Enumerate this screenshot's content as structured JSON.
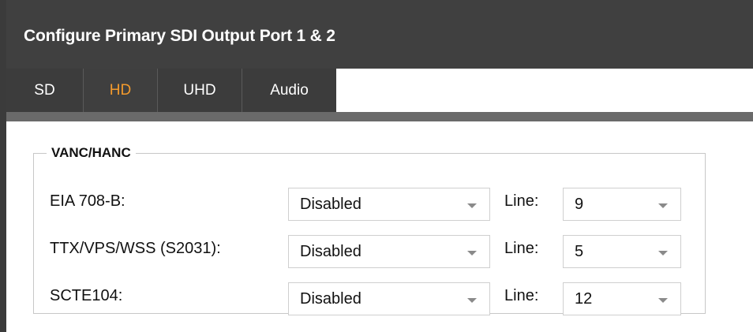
{
  "title": "Configure Primary SDI Output Port 1 & 2",
  "tabs": [
    {
      "label": "SD",
      "active": false
    },
    {
      "label": "HD",
      "active": true
    },
    {
      "label": "UHD",
      "active": false
    },
    {
      "label": "Audio",
      "active": false
    }
  ],
  "colors": {
    "title_bar": "#404040",
    "active_tab_text": "#f39a2c",
    "tab_text": "#ffffff"
  },
  "group": {
    "legend": "VANC/HANC",
    "line_label": "Line:",
    "rows": [
      {
        "label": "EIA 708-B:",
        "mode": "Disabled",
        "line": "9"
      },
      {
        "label": "TTX/VPS/WSS (S2031):",
        "mode": "Disabled",
        "line": "5"
      },
      {
        "label": "SCTE104:",
        "mode": "Disabled",
        "line": "12"
      }
    ]
  }
}
